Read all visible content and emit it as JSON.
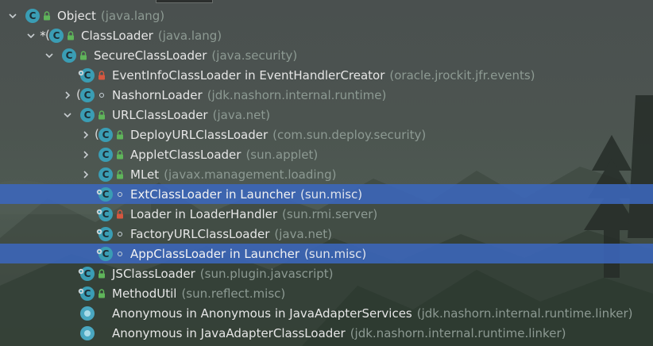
{
  "tree": {
    "nodes": [
      {
        "label": "Object",
        "package": "(java.lang)",
        "indent": 0,
        "expand": "down",
        "icon": "class",
        "visibility": "public"
      },
      {
        "label": "ClassLoader",
        "package": "(java.lang)",
        "indent": 1,
        "expand": "down",
        "icon": "abstract-class",
        "visibility": "public",
        "marker": "*"
      },
      {
        "label": "SecureClassLoader",
        "package": "(java.security)",
        "indent": 2,
        "expand": "down",
        "icon": "class",
        "visibility": "public"
      },
      {
        "label": "EventInfoClassLoader in EventHandlerCreator",
        "package": "(oracle.jrockit.jfr.events)",
        "indent": 3,
        "expand": "none",
        "icon": "inner-class",
        "visibility": "private"
      },
      {
        "label": "NashornLoader",
        "package": "(jdk.nashorn.internal.runtime)",
        "indent": 3,
        "expand": "right",
        "icon": "abstract-class",
        "visibility": "package"
      },
      {
        "label": "URLClassLoader",
        "package": "(java.net)",
        "indent": 3,
        "expand": "down",
        "icon": "class",
        "visibility": "public"
      },
      {
        "label": "DeployURLClassLoader",
        "package": "(com.sun.deploy.security)",
        "indent": 4,
        "expand": "right",
        "icon": "abstract-class",
        "visibility": "public"
      },
      {
        "label": "AppletClassLoader",
        "package": "(sun.applet)",
        "indent": 4,
        "expand": "right",
        "icon": "class",
        "visibility": "public"
      },
      {
        "label": "MLet",
        "package": "(javax.management.loading)",
        "indent": 4,
        "expand": "right",
        "icon": "class",
        "visibility": "public"
      },
      {
        "label": "ExtClassLoader in Launcher",
        "package": "(sun.misc)",
        "indent": 4,
        "expand": "none",
        "icon": "inner-class",
        "visibility": "package",
        "selected": true
      },
      {
        "label": "Loader in LoaderHandler",
        "package": "(sun.rmi.server)",
        "indent": 4,
        "expand": "none",
        "icon": "inner-class",
        "visibility": "private"
      },
      {
        "label": "FactoryURLClassLoader",
        "package": "(java.net)",
        "indent": 4,
        "expand": "none",
        "icon": "inner-class",
        "visibility": "package"
      },
      {
        "label": "AppClassLoader in Launcher",
        "package": "(sun.misc)",
        "indent": 4,
        "expand": "none",
        "icon": "inner-class",
        "visibility": "package",
        "selected": true
      },
      {
        "label": "JSClassLoader",
        "package": "(sun.plugin.javascript)",
        "indent": 3,
        "expand": "none",
        "icon": "inner-class",
        "visibility": "public"
      },
      {
        "label": "MethodUtil",
        "package": "(sun.reflect.misc)",
        "indent": 3,
        "expand": "none",
        "icon": "inner-class",
        "visibility": "public"
      },
      {
        "label": "Anonymous in Anonymous in JavaAdapterServices",
        "package": "(jdk.nashorn.internal.runtime.linker)",
        "indent": 3,
        "expand": "none",
        "icon": "anonymous",
        "visibility": "none"
      },
      {
        "label": "Anonymous in JavaAdapterClassLoader",
        "package": "(jdk.nashorn.internal.runtime.linker)",
        "indent": 3,
        "expand": "none",
        "icon": "anonymous",
        "visibility": "none"
      }
    ]
  },
  "colors": {
    "selection": "#3b67bc",
    "class_icon": "#3a9db4",
    "public_lock": "#5fb55a",
    "private_lock": "#d6573f",
    "package_text": "#8d9a93"
  }
}
